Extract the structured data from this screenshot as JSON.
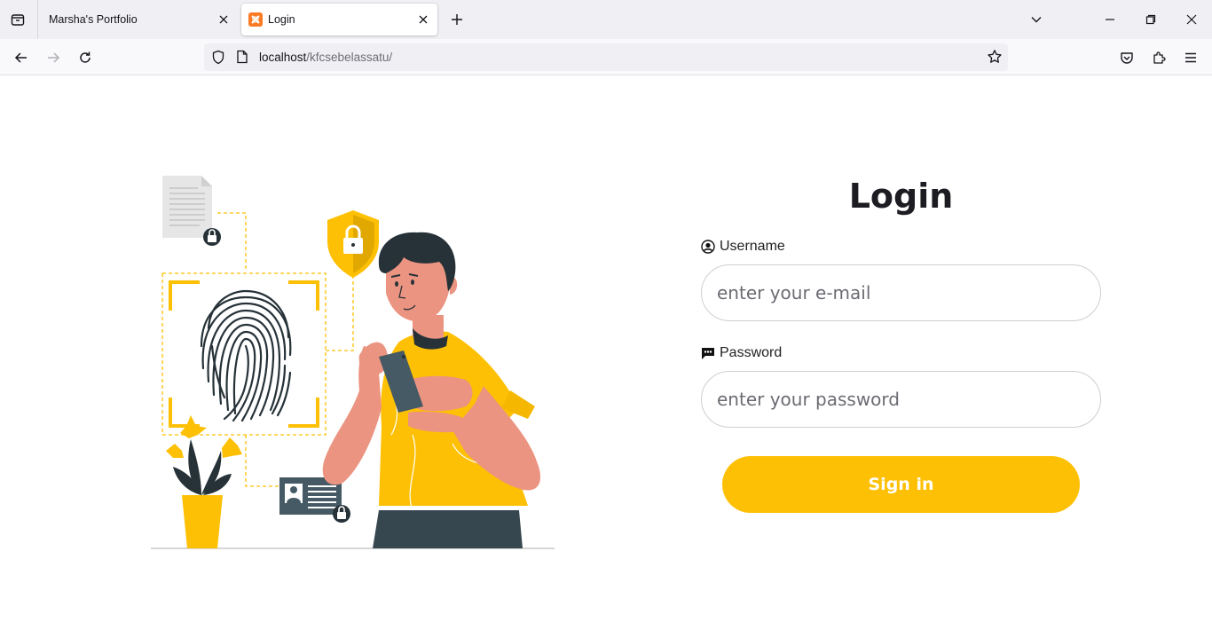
{
  "browser": {
    "tabs": [
      {
        "title": "Marsha's Portfolio",
        "active": false
      },
      {
        "title": "Login",
        "active": true
      }
    ],
    "url_host": "localhost",
    "url_path": "/kfcsebelassatu/"
  },
  "login": {
    "heading": "Login",
    "username_label": "Username",
    "username_placeholder": "enter your e-mail",
    "password_label": "Password",
    "password_placeholder": "enter your password",
    "submit_label": "Sign in"
  },
  "colors": {
    "accent": "#fec005",
    "skin": "#eb9481",
    "dark": "#37474f"
  }
}
